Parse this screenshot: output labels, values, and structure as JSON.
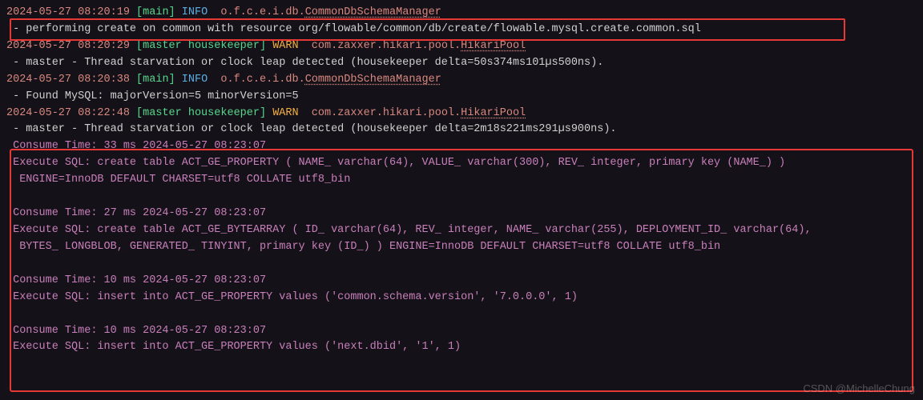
{
  "colors": {
    "bg": "#141218",
    "timestamp": "#d98880",
    "thread": "#58d68d",
    "info": "#5dade2",
    "warn": "#f5b041",
    "logger": "#d98880",
    "text": "#d0d0d0",
    "sql": "#c97fbb",
    "highlight_border": "#e63935"
  },
  "lines": {
    "l0": {
      "ts": "2024-05-27 08:20:19",
      "thread": "[main]",
      "level": "INFO",
      "cls_prefix": "o.f.c.e.i.db.",
      "cls_name": "CommonDbSchemaManager"
    },
    "l1": {
      "msg": " - performing create on common with resource org/flowable/common/db/create/flowable.mysql.create.common.sql"
    },
    "l2": {
      "ts": "2024-05-27 08:20:29",
      "thread": "[master housekeeper]",
      "level": "WARN",
      "cls_prefix": "com.zaxxer.hikari.pool.",
      "cls_name": "HikariPool"
    },
    "l3": {
      "msg": " - master - Thread starvation or clock leap detected (housekeeper delta=50s374ms101µs500ns)."
    },
    "l4": {
      "ts": "2024-05-27 08:20:38",
      "thread": "[main]",
      "level": "INFO",
      "cls_prefix": "o.f.c.e.i.db.",
      "cls_name": "CommonDbSchemaManager"
    },
    "l5": {
      "msg": " - Found MySQL: majorVersion=5 minorVersion=5"
    },
    "l6": {
      "ts": "2024-05-27 08:22:48",
      "thread": "[master housekeeper]",
      "level": "WARN",
      "cls_prefix": "com.zaxxer.hikari.pool.",
      "cls_name": "HikariPool"
    },
    "l7": {
      "msg": " - master - Thread starvation or clock leap detected (housekeeper delta=2m18s221ms291µs900ns)."
    },
    "l8": {
      "sql": " Consume Time: 33 ms 2024-05-27 08:23:07"
    },
    "l9": {
      "sql": " Execute SQL: create table ACT_GE_PROPERTY ( NAME_ varchar(64), VALUE_ varchar(300), REV_ integer, primary key (NAME_) )"
    },
    "l10": {
      "sql": "  ENGINE=InnoDB DEFAULT CHARSET=utf8 COLLATE utf8_bin"
    },
    "l11": {
      "sql": " "
    },
    "l12": {
      "sql": " Consume Time: 27 ms 2024-05-27 08:23:07"
    },
    "l13": {
      "sql": " Execute SQL: create table ACT_GE_BYTEARRAY ( ID_ varchar(64), REV_ integer, NAME_ varchar(255), DEPLOYMENT_ID_ varchar(64),"
    },
    "l14": {
      "sql": "  BYTES_ LONGBLOB, GENERATED_ TINYINT, primary key (ID_) ) ENGINE=InnoDB DEFAULT CHARSET=utf8 COLLATE utf8_bin"
    },
    "l15": {
      "sql": " "
    },
    "l16": {
      "sql": " Consume Time: 10 ms 2024-05-27 08:23:07"
    },
    "l17": {
      "sql": " Execute SQL: insert into ACT_GE_PROPERTY values ('common.schema.version', '7.0.0.0', 1)"
    },
    "l18": {
      "sql": " "
    },
    "l19": {
      "sql": " Consume Time: 10 ms 2024-05-27 08:23:07"
    },
    "l20": {
      "sql": " Execute SQL: insert into ACT_GE_PROPERTY values ('next.dbid', '1', 1)"
    }
  },
  "watermark": "CSDN @MichelleChung"
}
